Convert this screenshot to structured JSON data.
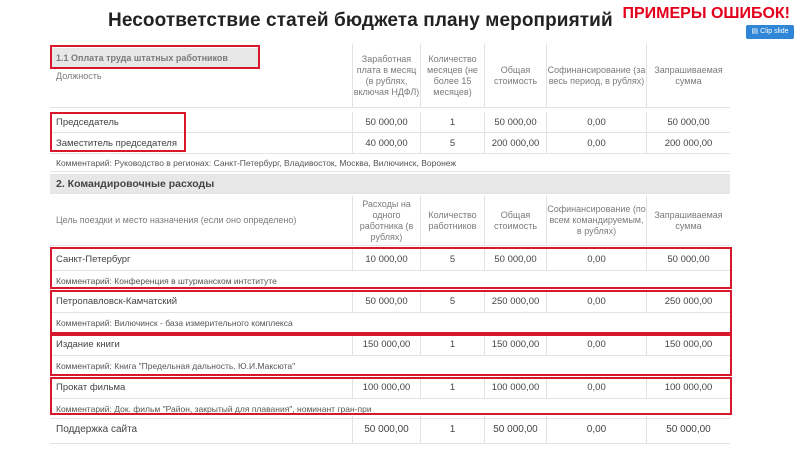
{
  "header": {
    "title": "Несоответствие статей бюджета плану мероприятий",
    "badge": "ПРИМЕРЫ ОШИБОК!",
    "clip_label": "Clip slide"
  },
  "section1": {
    "title": "1.1 Оплата труда штатных работников",
    "col0": "Должность",
    "col1": "Заработная плата в месяц (в рублях, включая НДФЛ)",
    "col2": "Количество месяцев (не более 15 месяцев)",
    "col3": "Общая стоимость",
    "col4": "Софинансирование (за весь период, в рублях)",
    "col5": "Запрашиваемая сумма",
    "rows": [
      {
        "name": "Председатель",
        "rate": "50 000,00",
        "qty": "1",
        "total": "50 000,00",
        "cofin": "0,00",
        "request": "50 000,00"
      },
      {
        "name": "Заместитель председателя",
        "rate": "40 000,00",
        "qty": "5",
        "total": "200 000,00",
        "cofin": "0,00",
        "request": "200 000,00"
      }
    ],
    "comment": "Комментарий: Руководство в регионах: Санкт-Петербург, Владивосток, Москва, Вилючинск, Воронеж"
  },
  "section2": {
    "title": "2. Командировочные расходы",
    "col0": "Цель поездки и место назначения (если оно определено)",
    "col1": "Расходы на одного работника (в рублях)",
    "col2": "Количество работников",
    "col3": "Общая стоимость",
    "col4": "Софинансирование (по всем командируемым, в рублях)",
    "col5": "Запрашиваемая сумма",
    "rows": [
      {
        "name": "Санкт-Петербург",
        "rate": "10 000,00",
        "qty": "5",
        "total": "50 000,00",
        "cofin": "0,00",
        "request": "50 000,00",
        "comment": "Комментарий: Конференция в штурманском интституте"
      },
      {
        "name": "Петропавловск-Камчатский",
        "rate": "50 000,00",
        "qty": "5",
        "total": "250 000,00",
        "cofin": "0,00",
        "request": "250 000,00",
        "comment": "Комментарий: Вилючинск - база измерительного комплекса"
      },
      {
        "name": "Издание книги",
        "rate": "150 000,00",
        "qty": "1",
        "total": "150 000,00",
        "cofin": "0,00",
        "request": "150 000,00",
        "comment": "Комментарий: Книга \"Предельная дальность. Ю.И.Максюта\""
      },
      {
        "name": "Прокат фильма",
        "rate": "100 000,00",
        "qty": "1",
        "total": "100 000,00",
        "cofin": "0,00",
        "request": "100 000,00",
        "comment": "Комментарий: Док. фильм \"Район, закрытый для плавания\", номинант гран-при"
      },
      {
        "name": "Поддержка сайта",
        "rate": "50 000,00",
        "qty": "1",
        "total": "50 000,00",
        "cofin": "0,00",
        "request": "50 000,00"
      }
    ]
  }
}
